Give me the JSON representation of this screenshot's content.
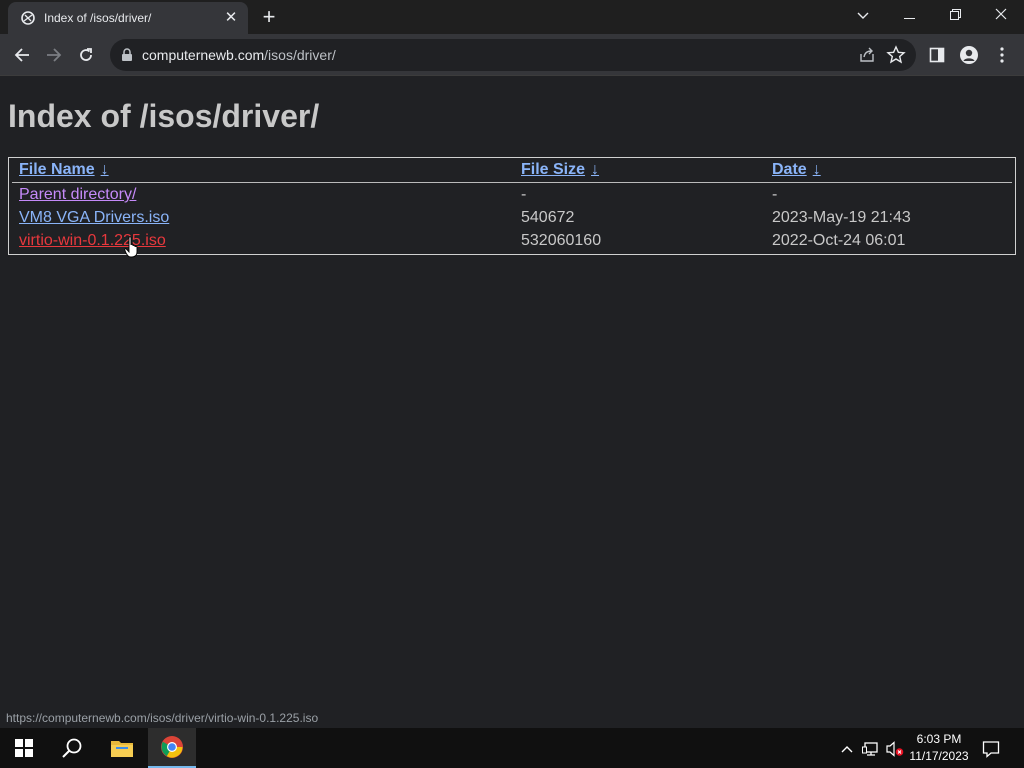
{
  "browser": {
    "tab_title": "Index of /isos/driver/",
    "url_host": "computernewb.com",
    "url_path": "/isos/driver/"
  },
  "page": {
    "heading": "Index of /isos/driver/",
    "columns": [
      {
        "label": "File Name",
        "arrow": "↓"
      },
      {
        "label": "File Size",
        "arrow": "↓"
      },
      {
        "label": "Date",
        "arrow": "↓"
      }
    ],
    "rows": [
      {
        "name": "Parent directory/",
        "size": "-",
        "date": "-"
      },
      {
        "name": "VM8 VGA Drivers.iso",
        "size": "540672",
        "date": "2023-May-19 21:43"
      },
      {
        "name": "virtio-win-0.1.225.iso",
        "size": "532060160",
        "date": "2022-Oct-24 06:01"
      }
    ]
  },
  "status_url": "https://computernewb.com/isos/driver/virtio-win-0.1.225.iso",
  "taskbar": {
    "time": "6:03 PM",
    "date": "11/17/2023"
  },
  "colors": {
    "link": "#8ab4f8",
    "visited": "#c58af9",
    "hover": "#e8383d"
  }
}
